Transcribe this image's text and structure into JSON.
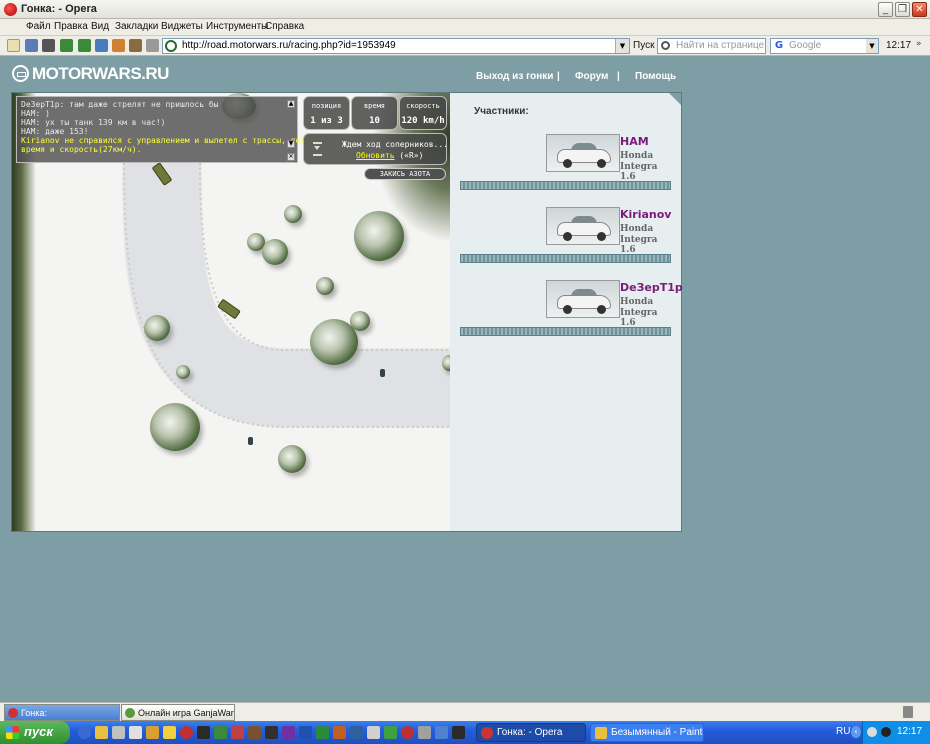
{
  "window": {
    "title": "Гонка: - Opera"
  },
  "menu": [
    "Файл",
    "Правка",
    "Вид",
    "Закладки",
    "Виджеты",
    "Инструменты",
    "Справка"
  ],
  "toolbar": {
    "url": "http://road.motorwars.ru/racing.php?id=1953949",
    "go_label": "Пуск",
    "find_placeholder": "Найти на странице",
    "search_engine": "Google",
    "clock": "12:17"
  },
  "site": {
    "logo": "MOTORWARS.RU",
    "nav": [
      "Выход из гонки",
      "|",
      "Форум",
      "|",
      "Помощь"
    ]
  },
  "chat": [
    {
      "text": "DeЗерТ1р: там даже стрелят не пришлось бы",
      "color": "#e8e8e8"
    },
    {
      "text": "HAM: )",
      "color": "#e8e8e8"
    },
    {
      "text": "HAM: ух ты танк 139 км в час!)",
      "color": "#e8e8e8"
    },
    {
      "text": "HAM: даже 153!",
      "color": "#e8e8e8"
    },
    {
      "text": "Kirianov не справился с управлением и вылетел с трассы, потерял",
      "color": "#ffff33"
    },
    {
      "text": "время и скорость(27км/ч).",
      "color": "#ffff33"
    }
  ],
  "stats": [
    {
      "label": "позиция",
      "value": "1 из 3"
    },
    {
      "label": "время",
      "value": "10"
    },
    {
      "label": "скорость",
      "value": "120 km/h"
    }
  ],
  "waiting": {
    "line1": "Ждем ход соперников...",
    "refresh": "Обновить",
    "hotkey": "(«R»)"
  },
  "nitro_button": "ЗАКИСЬ АЗОТА",
  "participants": {
    "heading": "Участники:",
    "list": [
      {
        "name": "HAM",
        "model1": "Honda",
        "model2": "Integra 1.6"
      },
      {
        "name": "Kirianov",
        "model1": "Honda",
        "model2": "Integra 1.6"
      },
      {
        "name": "DeЗерТ1р",
        "model1": "Honda",
        "model2": "Integra 1.6"
      }
    ]
  },
  "opera_tabs": [
    {
      "label": "Гонка:",
      "active": true
    },
    {
      "label": "Онлайн игра GanjaWars...",
      "active": false
    }
  ],
  "taskbar": {
    "start": "пуск",
    "tasks": [
      {
        "label": "Гонка: - Opera",
        "active": true
      },
      {
        "label": "Безымянный - Paint",
        "active": false
      }
    ],
    "lang": "RU",
    "clock": "12:17"
  },
  "colors": {
    "page_bg": "#7d9ea4",
    "racer_name": "#7a1a7a",
    "chat_system": "#ffff33",
    "link_yellow": "#ffff00"
  }
}
